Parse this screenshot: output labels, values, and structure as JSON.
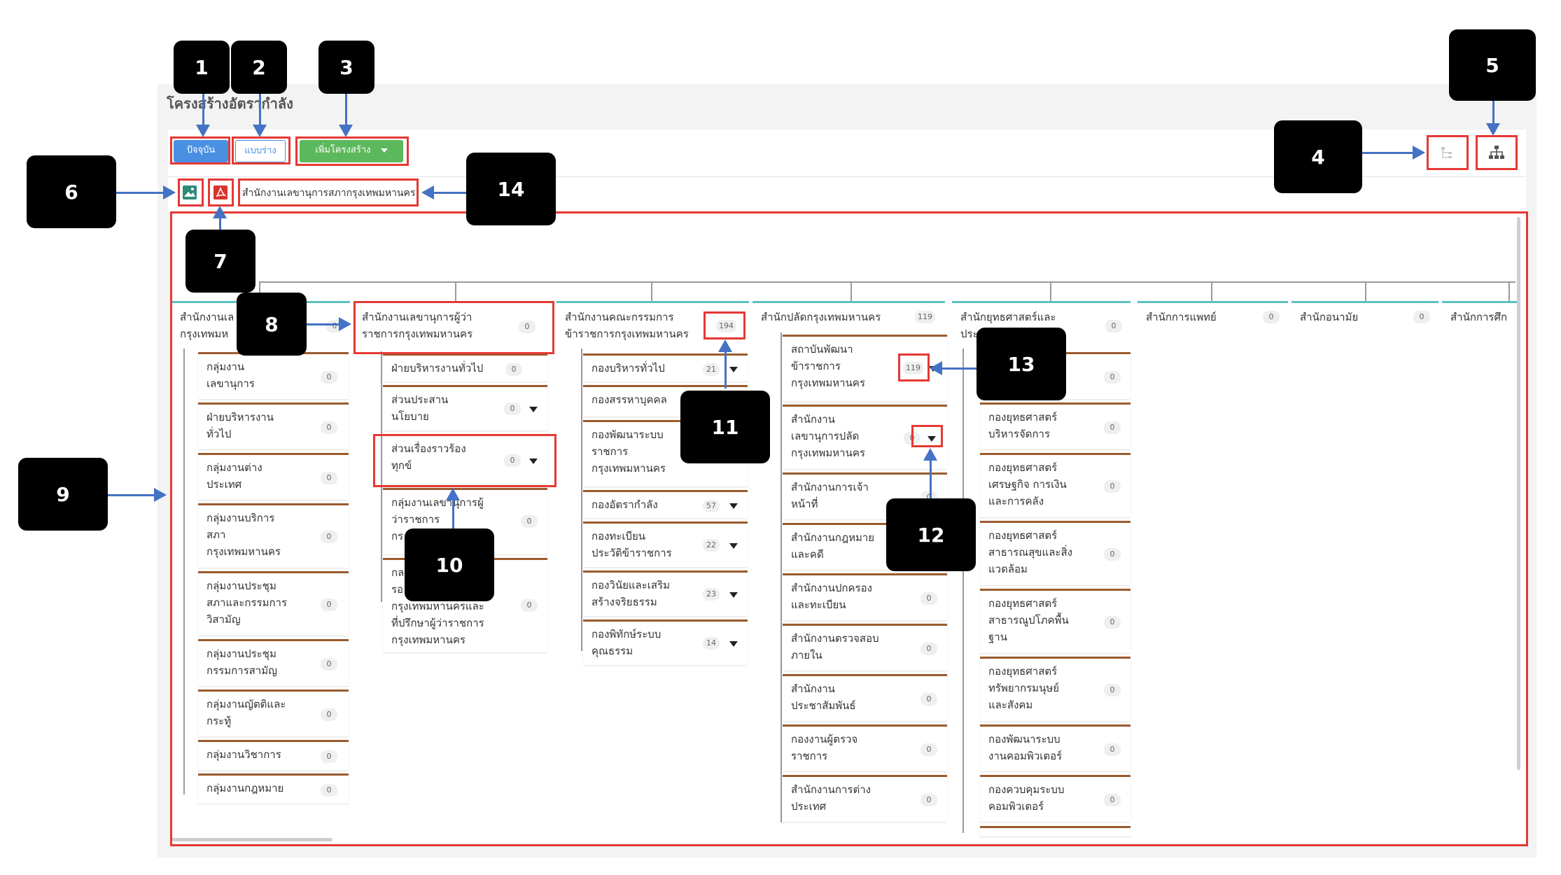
{
  "page_title": "โครงสร้างอัตรากำลัง",
  "toolbar": {
    "current_label": "ปัจจุบัน",
    "draft_label": "แบบร่าง",
    "add_structure_label": "เพิ่มโครงสร้าง"
  },
  "breadcrumb": "สำนักงานเลขานุการสภากรุงเทพมหานคร",
  "callouts": [
    "1",
    "2",
    "3",
    "4",
    "5",
    "6",
    "7",
    "8",
    "9",
    "10",
    "11",
    "12",
    "13",
    "14"
  ],
  "columns": [
    {
      "title": "สำนักงานเลขานุการสภากรุงเทพมหานคร",
      "title_visible": "สำนักงานเล\nกรุงเทพมห",
      "count": "0",
      "children": [
        {
          "name": "กลุ่มงาน\nเลขานุการ",
          "count": "0"
        },
        {
          "name": "ฝ่ายบริหารงาน\nทั่วไป",
          "count": "0"
        },
        {
          "name": "กลุ่มงานต่าง\nประเทศ",
          "count": "0"
        },
        {
          "name": "กลุ่มงานบริการ\nสภา\nกรุงเทพมหานคร",
          "count": "0"
        },
        {
          "name": "กลุ่มงานประชุม\nสภาและกรรมการ\nวิสามัญ",
          "count": "0"
        },
        {
          "name": "กลุ่มงานประชุม\nกรรมการสามัญ",
          "count": "0"
        },
        {
          "name": "กลุ่มงานญัตติและ\nกระทู้",
          "count": "0"
        },
        {
          "name": "กลุ่มงานวิชาการ",
          "count": "0"
        },
        {
          "name": "กลุ่มงานกฎหมาย",
          "count": "0"
        }
      ]
    },
    {
      "title": "สำนักงานเลขานุการผู้ว่าราชการกรุงเทพมหานคร",
      "title_visible": "สำนักงานเลขานุการผู้ว่า\nราชการกรุงเทพมหานคร",
      "count": "0",
      "children": [
        {
          "name": "ฝ่ายบริหารงานทั่วไป",
          "count": "0"
        },
        {
          "name": "ส่วนประสาน\nนโยบาย",
          "count": "0"
        },
        {
          "name": "ส่วนเรื่องราวร้อง\nทุกข์",
          "count": "0"
        },
        {
          "name": "กลุ่มงานเลขานุการผู้\nว่าราชการ\nกร",
          "count": "0"
        },
        {
          "name": "กล\nรอ\nกรุงเทพมหานครและ\nที่ปรึกษาผู้ว่าราชการ\nกรุงเทพมหานคร",
          "count": "0"
        }
      ]
    },
    {
      "title": "สำนักงานคณะกรรมการข้าราชการกรุงเทพมหานคร",
      "title_visible": "สำนักงานคณะกรรมการ\nข้าราชการกรุงเทพมหานคร",
      "count": "194",
      "children": [
        {
          "name": "กองบริหารทั่วไป",
          "count": "21"
        },
        {
          "name": "กองสรรหาบุคคล",
          "count": ""
        },
        {
          "name": "กองพัฒนาระบบ\nราชการ\nกรุงเทพมหานคร",
          "count": ""
        },
        {
          "name": "กองอัตรากำลัง",
          "count": "57"
        },
        {
          "name": "กองทะเบียน\nประวัติข้าราชการ",
          "count": "22"
        },
        {
          "name": "กองวินัยและเสริม\nสร้างจริยธรรม",
          "count": "23"
        },
        {
          "name": "กองพิทักษ์ระบบ\nคุณธรรม",
          "count": "14"
        }
      ]
    },
    {
      "title": "สำนักปลัดกรุงเทพมหานคร",
      "title_visible": "สำนักปลัดกรุงเทพมหานคร",
      "count": "119",
      "children": [
        {
          "name": "สถาบันพัฒนา\nข้าราชการ\nกรุงเทพมหานคร",
          "count": "119"
        },
        {
          "name": "สำนักงาน\nเลขานุการปลัด\nกรุงเทพมหานคร",
          "count": "0"
        },
        {
          "name": "สำนักงานการเจ้า\nหน้าที่",
          "count": "0"
        },
        {
          "name": "สำนักงานกฎหมาย\nและคดี",
          "count": "0"
        },
        {
          "name": "สำนักงานปกครอง\nและทะเบียน",
          "count": "0"
        },
        {
          "name": "สำนักงานตรวจสอบ\nภายใน",
          "count": "0"
        },
        {
          "name": "สำนักงาน\nประชาสัมพันธ์",
          "count": "0"
        },
        {
          "name": "กองงานผู้ตรวจ\nราชการ",
          "count": "0"
        },
        {
          "name": "สำนักงานการต่าง\nประเทศ",
          "count": "0"
        }
      ]
    },
    {
      "title": "สำนักยุทธศาสตร์และประเมินผล",
      "title_visible": "สำนักยุทธศาสตร์และ\nประ",
      "count": "0",
      "children": [
        {
          "name": "",
          "count": "0"
        },
        {
          "name": "กองยุทธศาสตร์\nบริหารจัดการ",
          "count": "0"
        },
        {
          "name": "กองยุทธศาสตร์\nเศรษฐกิจ การเงิน\nและการคลัง",
          "count": "0"
        },
        {
          "name": "กองยุทธศาสตร์\nสาธารณสุขและสิ่ง\nแวดล้อม",
          "count": "0"
        },
        {
          "name": "กองยุทธศาสตร์\nสาธารณูปโภคพื้น\nฐาน",
          "count": "0"
        },
        {
          "name": "กองยุทธศาสตร์\nทรัพยากรมนุษย์\nและสังคม",
          "count": "0"
        },
        {
          "name": "กองพัฒนาระบบ\nงานคอมพิวเตอร์",
          "count": "0"
        },
        {
          "name": "กองควบคุมระบบ\nคอมพิวเตอร์",
          "count": "0"
        }
      ]
    },
    {
      "title": "สำนักการแพทย์",
      "title_visible": "สำนักการแพทย์",
      "count": "0",
      "children": []
    },
    {
      "title": "สำนักอนามัย",
      "title_visible": "สำนักอนามัย",
      "count": "0",
      "children": []
    },
    {
      "title": "สำนักการศึกษา",
      "title_visible": "สำนักการศึก",
      "count": "",
      "children": []
    }
  ]
}
